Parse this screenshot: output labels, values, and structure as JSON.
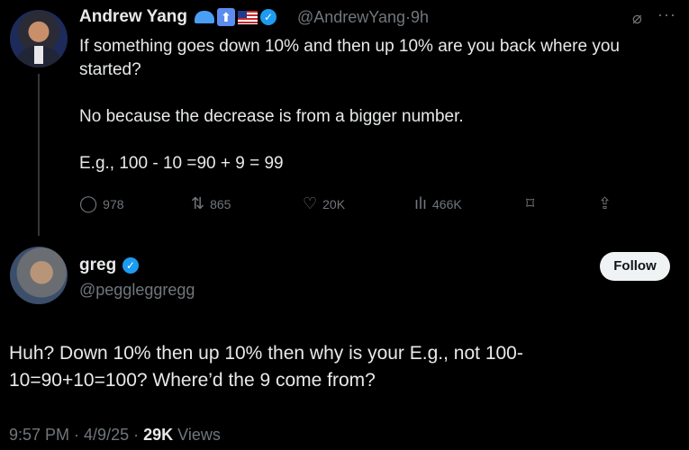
{
  "parent_tweet": {
    "author_name": "Andrew Yang",
    "badges": [
      "cap-icon",
      "up-arrow-icon",
      "us-flag-icon",
      "verified-icon"
    ],
    "handle": "@AndrewYang",
    "separator": "·",
    "age": "9h",
    "text_lines": [
      "If something goes down 10% and then up 10% are you back where you started?",
      "No because the decrease is from a bigger number.",
      "E.g., 100 - 10 =90 + 9 = 99"
    ],
    "actions": {
      "replies": "978",
      "reposts": "865",
      "likes": "20K",
      "views": "466K"
    }
  },
  "reply_tweet": {
    "author_name": "greg",
    "handle": "@peggleggregg",
    "follow_label": "Follow",
    "text": "Huh? Down 10% then up 10% then why is your E.g., not 100-10=90+10=100? Where’d the 9 come from?",
    "meta": {
      "time": "9:57 PM",
      "date": "4/9/25",
      "views_count": "29K",
      "views_label": "Views"
    }
  },
  "colors": {
    "background": "#000000",
    "text_primary": "#e7e9ea",
    "text_secondary": "#71767b",
    "verified_blue": "#1d9bf0"
  }
}
